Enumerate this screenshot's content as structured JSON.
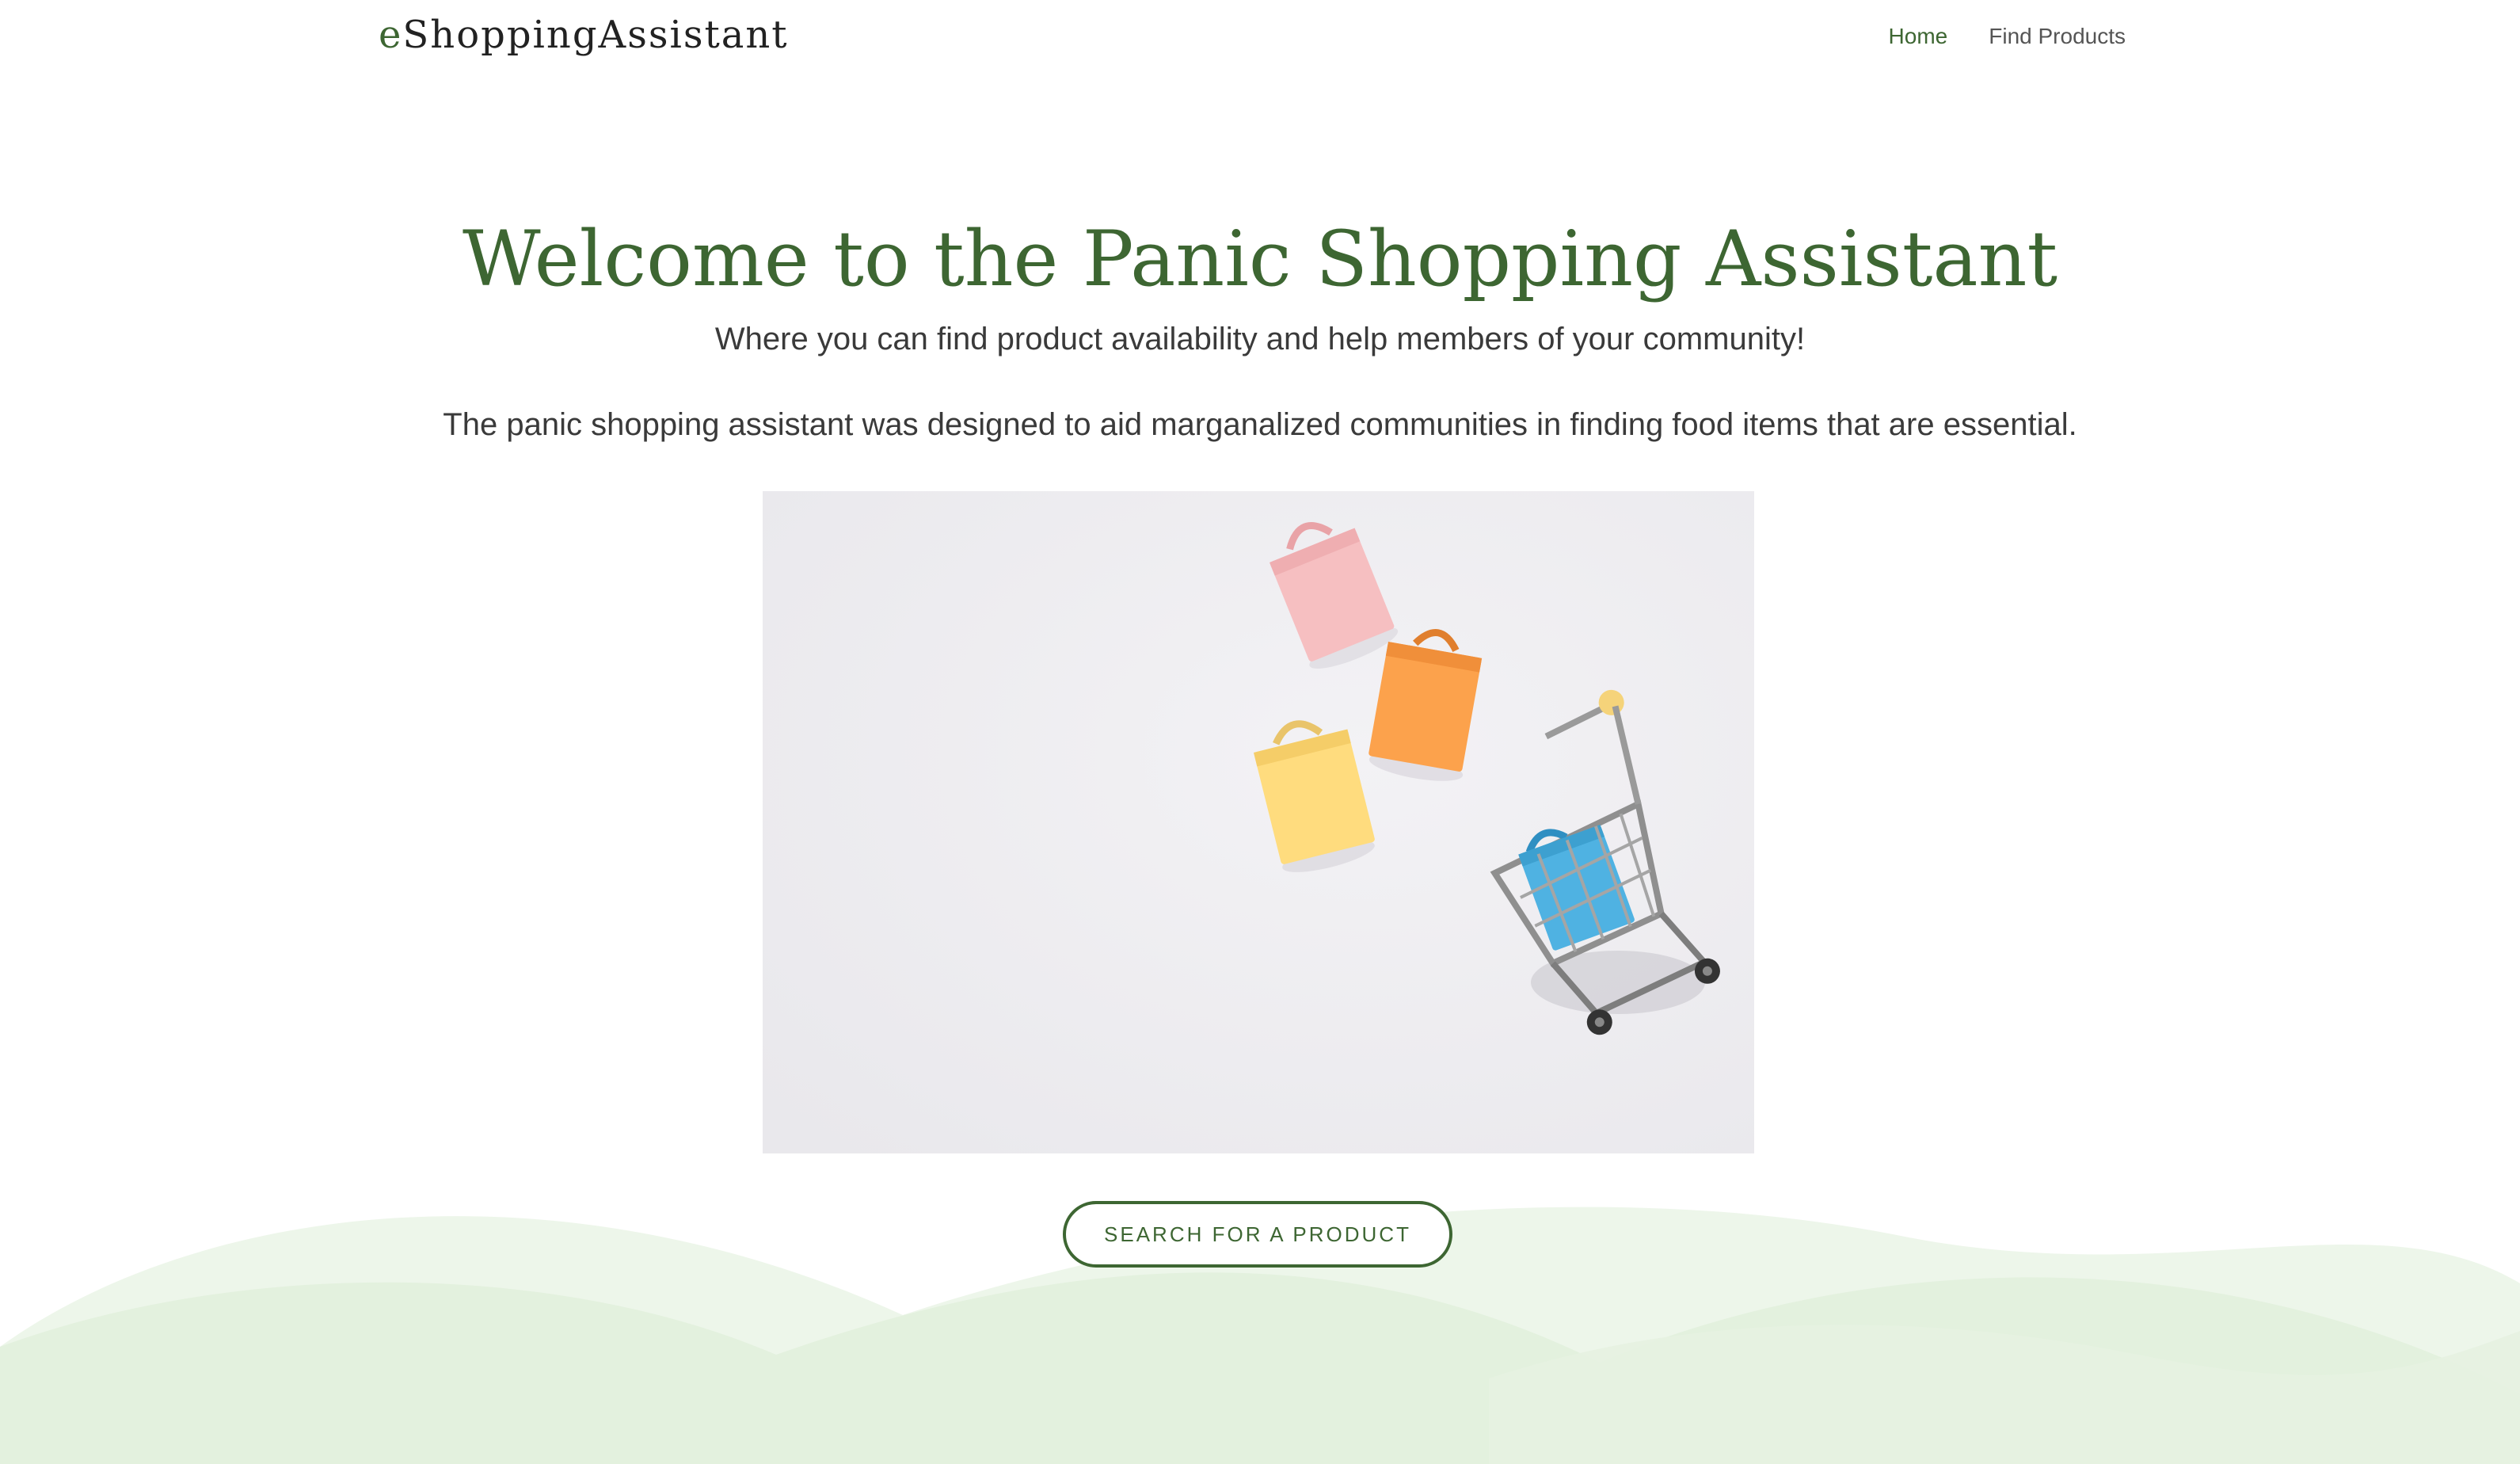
{
  "brand": {
    "prefix": "e",
    "rest": "ShoppingAssistant"
  },
  "nav": {
    "items": [
      {
        "label": "Home",
        "active": true
      },
      {
        "label": "Find Products",
        "active": false
      }
    ]
  },
  "hero": {
    "title": "Welcome to the Panic Shopping Assistant",
    "subtitle": "Where you can find product availability and help members of your community!",
    "description": "The panic shopping assistant was designed to aid marganalized communities in finding food items that are essential."
  },
  "cta": {
    "label": "SEARCH FOR A PRODUCT"
  },
  "colors": {
    "brand_green": "#3d6632",
    "hill_light": "#edf6ea",
    "hill_mid": "#e3f1de",
    "image_bg": "#eeedf0"
  }
}
